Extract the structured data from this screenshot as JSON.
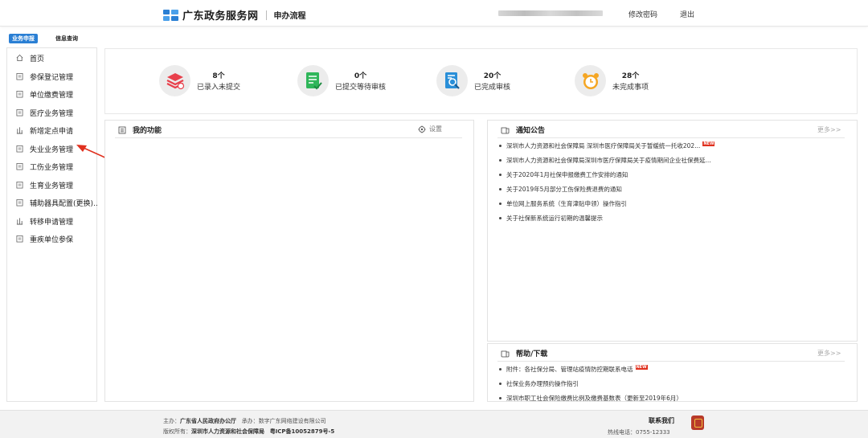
{
  "header": {
    "site_name": "广东政务服务网",
    "subtitle": "申办流程",
    "change_password": "修改密码",
    "logout": "退出"
  },
  "top_tabs": [
    {
      "label": "业务申报",
      "active": true
    },
    {
      "label": "信息查询",
      "active": false
    }
  ],
  "sidebar": {
    "items": [
      {
        "label": "首页",
        "icon": "home-icon"
      },
      {
        "label": "参保登记管理",
        "icon": "document-icon"
      },
      {
        "label": "单位缴费管理",
        "icon": "document-icon"
      },
      {
        "label": "医疗业务管理",
        "icon": "document-icon"
      },
      {
        "label": "新增定点申请",
        "icon": "chart-icon"
      },
      {
        "label": "失业业务管理",
        "icon": "document-icon"
      },
      {
        "label": "工伤业务管理",
        "icon": "document-icon"
      },
      {
        "label": "生育业务管理",
        "icon": "document-icon"
      },
      {
        "label": "辅助器具配置(更换)...",
        "icon": "document-icon"
      },
      {
        "label": "转移申请管理",
        "icon": "chart-icon"
      },
      {
        "label": "重疾单位参保",
        "icon": "document-icon"
      }
    ]
  },
  "stats": [
    {
      "count": "8个",
      "label": "已录入未提交",
      "icon": "stack-icon",
      "color": "#e8404c"
    },
    {
      "count": "0个",
      "label": "已提交等待审核",
      "icon": "checklist-icon",
      "color": "#2fb65a"
    },
    {
      "count": "20个",
      "label": "已完成审核",
      "icon": "doc-search-icon",
      "color": "#2a8fd8"
    },
    {
      "count": "28个",
      "label": "未完成事项",
      "icon": "alarm-clock-icon",
      "color": "#f5a623"
    }
  ],
  "my_functions": {
    "title": "我的功能",
    "settings": "设置"
  },
  "notices": {
    "title": "通知公告",
    "more": "更多>>",
    "items": [
      {
        "text": "深圳市人力资源和社会保障局 深圳市医疗保障局关于暂缓统一托收202...",
        "new": true
      },
      {
        "text": "深圳市人力资源和社会保障局深圳市医疗保障局关于疫情期间企业社保费延...",
        "new": false
      },
      {
        "text": "关于2020年1月社保申报缴费工作安排的通知",
        "new": false
      },
      {
        "text": "关于2019年5月部分工伤保险费退费的通知",
        "new": false
      },
      {
        "text": "单位网上服务系统（生育津贴申领）操作指引",
        "new": false
      },
      {
        "text": "关于社保新系统运行初期的温馨提示",
        "new": false
      }
    ]
  },
  "help": {
    "title": "帮助/下载",
    "more": "更多>>",
    "items": [
      {
        "text": "附件：各社保分局、管理站疫情防控期联系电话",
        "new": true
      },
      {
        "text": "社保业务办理预约操作指引",
        "new": false
      },
      {
        "text": "深圳市职工社会保险缴费比例及缴费基数表（更新至2019年6月）",
        "new": false
      }
    ]
  },
  "new_badge": "NEW",
  "footer": {
    "host_label": "主办：",
    "host": "广东省人民政府办公厅",
    "contractor_label": "承办：",
    "contractor": "数字广东网络建设有限公司",
    "copyright_label": "版权所有：",
    "copyright": "深圳市人力资源和社会保障局",
    "icp": "粤ICP备10052879号-5",
    "contact": "联系我们",
    "hotline": "热线电话：0755-12333"
  },
  "colors": {
    "primary": "#2a7fd4",
    "arrow": "#e0301e"
  }
}
